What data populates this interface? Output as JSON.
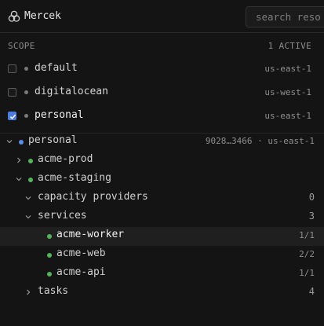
{
  "app": {
    "title": "Mercek"
  },
  "search": {
    "placeholder": "search resources"
  },
  "scope": {
    "heading": "SCOPE",
    "active_label": "1 ACTIVE"
  },
  "profiles": [
    {
      "name": "default",
      "region": "us-east-1",
      "checked": false
    },
    {
      "name": "digitalocean",
      "region": "us-west-1",
      "checked": false
    },
    {
      "name": "personal",
      "region": "us-east-1",
      "checked": true
    }
  ],
  "tree": {
    "profile": {
      "name": "personal",
      "account": "9028…3466",
      "separator": "·",
      "region": "us-east-1"
    },
    "clusters": [
      {
        "name": "acme-prod",
        "expanded": false
      },
      {
        "name": "acme-staging",
        "expanded": true
      }
    ],
    "groups": {
      "capacity": {
        "label": "capacity providers",
        "count": "0"
      },
      "services": {
        "label": "services",
        "count": "3"
      },
      "tasks": {
        "label": "tasks",
        "count": "4"
      }
    },
    "services": [
      {
        "name": "acme-worker",
        "count": "1/1",
        "status": "running"
      },
      {
        "name": "acme-web",
        "count": "2/2",
        "status": "running"
      },
      {
        "name": "acme-api",
        "count": "1/1",
        "status": "running"
      }
    ]
  },
  "colors": {
    "background": "#141414",
    "accent": "#4c7ddb",
    "status_running": "#57b35a",
    "profile_dot": "#5b8fe6"
  }
}
